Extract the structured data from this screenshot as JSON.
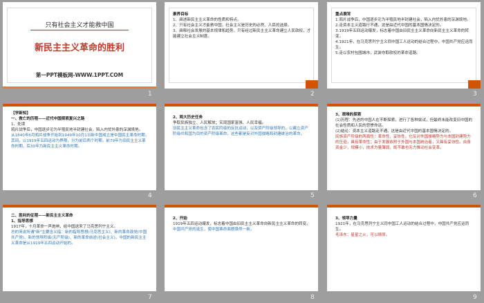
{
  "slides": [
    {
      "num": "1",
      "title1": "只有社会主义才能救中国",
      "title2": "新民主主义革命的胜利",
      "sub": "第一PPT模板网-WWW.1PPT.COM"
    },
    {
      "num": "2",
      "heading": "素养目标",
      "lines": [
        "1、阐述新民主主义革命的性质和特点。",
        "2、只有社会主义才能救中国，社会主义是历史的必然、人民的选择。",
        "3、阐释社会发展的基本规律和趋势，只有经过新民主主义革命建立人民政权，才能建立社会主义制度。"
      ]
    },
    {
      "num": "3",
      "heading": "重点展背",
      "lines": [
        "1.鸦片战争后，中国逐步沦为半殖民地半封建社会，陷入内忧外患的深渊境地。",
        "2.走资本主义道路行不通，这是由近代中国的基本国情决定的。",
        "3.1919年五四运动爆发，标志着中国由旧民主主义革命向新民主主义革命的转变。",
        "4.1921年，在马克思列宁主义同中国工人运动的结合过程中，中国共产党应运而生。",
        "5.走以农村包围城市，武装夺取政权的革命道路。"
      ]
    },
    {
      "num": "4",
      "tag": "【学新知】",
      "lines": [
        "一、救亡的历程——近代中国探索复兴之路",
        "1、处境",
        "鸦片战争后，中国逐步沦为半殖民地半封建社会，陷入内忧外患的深渊境地。",
        "从1840年6月鸦片战争开始到1949年10月1日新中国成立是中国民主革命时期，其间，以1919年五四运动为界限，分为前后两个时期，前79年为旧民主主义革命时期，后30年为新民主主义革命时期。"
      ]
    },
    {
      "num": "5",
      "lines": [
        "2、两大历史任务",
        "争取民族独立、人民解放；实现国家富强、人民幸福。",
        "旧民主主义革命包含了农民阶级的反抗运动，以及资产阶级领导的，以建立资产阶级共和国为目的资产阶级革命，这些都是反对外国侵略和封建统治的革命。"
      ]
    },
    {
      "num": "6",
      "lines": [
        "3、艰难的探索",
        "(1)历程：先进的中国人在不断探索，进行了各种尝试，但最终未能改变旧中国的社会性质和人民的悲惨命运。",
        "(2)结论：资本主义道路走不通。这是由近代中国的基本国情决定的。",
        "民族资产阶级的两面性：革命性，妥协性。它反对外国侵略势力与本国封建势力的压迫，具有革命性；由于发展依附于外国与本国统治者，又具有妥协性。自身资金少，规模小，技术力量薄弱，既不敢也无力推动社会变革。"
      ]
    },
    {
      "num": "7",
      "lines": [
        "二、胜利的征程——新民主主义革命",
        "1、指导思想",
        "1917年，十月革命一声炮响，给中国送来了马克思列宁主义。",
        "总的来说所谓\"新\"主要含义指：新的指导思想(马克思主义)、新的革命政党(中国共产党)、新的领导阶级(无产阶级)、新的革命前途(社会主义)。中国的新民主主义革命是从1919年五四运动开始的。"
      ]
    },
    {
      "num": "8",
      "lines": [
        "2、开始",
        "1919年五四运动爆发，标志着中国由旧民主主义革命向新民主主义革命的转变。",
        "中国共产党的诞生，使中国革命面貌焕然一新。"
      ]
    },
    {
      "num": "9",
      "lines": [
        "3、领导力量",
        "1921年，在马克思列宁主义同中国工人运动的结合过程中，中国共产党应运而生。",
        "毛泽东：星星之火，可以燎原。"
      ]
    }
  ]
}
